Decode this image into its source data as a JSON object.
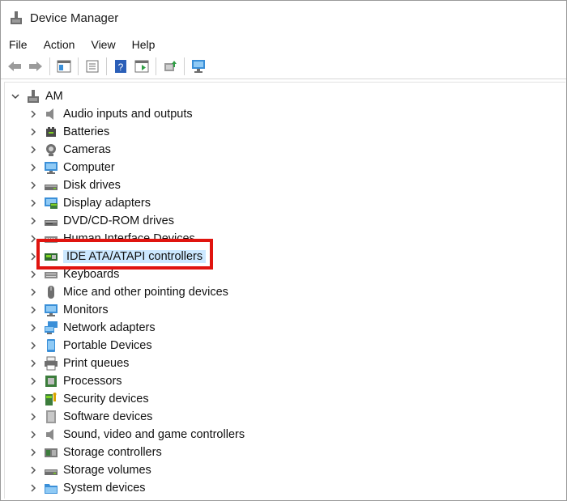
{
  "window": {
    "title": "Device Manager"
  },
  "menu": [
    "File",
    "Action",
    "View",
    "Help"
  ],
  "toolbar": [
    "back-icon",
    "forward-icon",
    "show-hide-tree-icon",
    "properties-icon",
    "help-icon",
    "action-pane-icon",
    "update-driver-icon",
    "scan-hardware-icon"
  ],
  "tree": {
    "root": "AM",
    "items": [
      {
        "label": "Audio inputs and outputs",
        "icon": "speaker-icon"
      },
      {
        "label": "Batteries",
        "icon": "battery-icon"
      },
      {
        "label": "Cameras",
        "icon": "camera-icon"
      },
      {
        "label": "Computer",
        "icon": "monitor-icon"
      },
      {
        "label": "Disk drives",
        "icon": "disk-icon"
      },
      {
        "label": "Display adapters",
        "icon": "display-adapter-icon"
      },
      {
        "label": "DVD/CD-ROM drives",
        "icon": "dvd-icon"
      },
      {
        "label": "Human Interface Devices",
        "icon": "hid-icon"
      },
      {
        "label": "IDE ATA/ATAPI controllers",
        "icon": "ide-controller-icon",
        "selected": true
      },
      {
        "label": "Keyboards",
        "icon": "keyboard-icon"
      },
      {
        "label": "Mice and other pointing devices",
        "icon": "mouse-icon"
      },
      {
        "label": "Monitors",
        "icon": "monitor-icon"
      },
      {
        "label": "Network adapters",
        "icon": "network-icon"
      },
      {
        "label": "Portable Devices",
        "icon": "portable-device-icon"
      },
      {
        "label": "Print queues",
        "icon": "printer-icon"
      },
      {
        "label": "Processors",
        "icon": "processor-icon"
      },
      {
        "label": "Security devices",
        "icon": "security-icon"
      },
      {
        "label": "Software devices",
        "icon": "software-device-icon"
      },
      {
        "label": "Sound, video and game controllers",
        "icon": "speaker-icon"
      },
      {
        "label": "Storage controllers",
        "icon": "storage-controller-icon"
      },
      {
        "label": "Storage volumes",
        "icon": "disk-icon"
      },
      {
        "label": "System devices",
        "icon": "system-folder-icon"
      }
    ]
  },
  "colors": {
    "selection": "#cce8ff",
    "highlight_border": "#e0140f",
    "icon_blue": "#3a8fd8"
  }
}
